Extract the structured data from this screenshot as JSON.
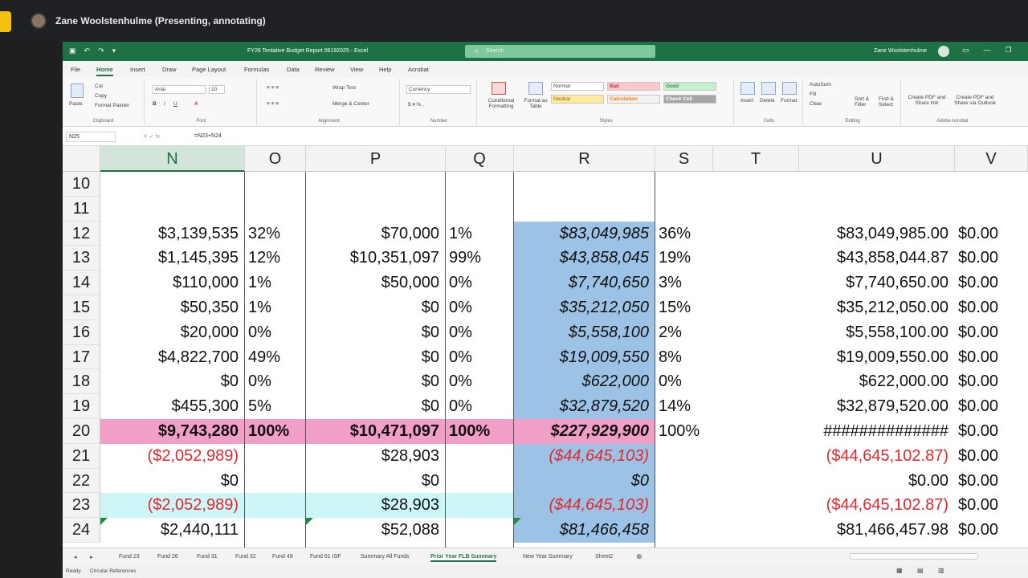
{
  "meeting": {
    "presenter_label": "Zane Woolstenhulme (Presenting, annotating)"
  },
  "excel": {
    "doc_title": "FY26 Tentative Budget Report 06192025  -  Excel",
    "search_placeholder": "Search",
    "user_name": "Zane Woolstenhulme",
    "tabs": [
      "File",
      "Home",
      "Insert",
      "Draw",
      "Page Layout",
      "Formulas",
      "Data",
      "Review",
      "View",
      "Help",
      "Acrobat"
    ],
    "ribbon": {
      "clipboard": {
        "paste": "Paste",
        "cut": "Cut",
        "copy": "Copy",
        "format_painter": "Format Painter",
        "label": "Clipboard"
      },
      "font": {
        "name": "Arial",
        "size": "10",
        "label": "Font"
      },
      "alignment": {
        "wrap": "Wrap Text",
        "merge": "Merge & Center",
        "label": "Alignment"
      },
      "number": {
        "format": "Currency",
        "label": "Number"
      },
      "styles": {
        "conditional": "Conditional Formatting",
        "format_table": "Format as Table",
        "normal": "Normal",
        "bad": "Bad",
        "good": "Good",
        "neutral": "Neutral",
        "calculation": "Calculation",
        "check_cell": "Check Cell",
        "label": "Styles"
      },
      "cells": {
        "insert": "Insert",
        "delete": "Delete",
        "format": "Format",
        "label": "Cells"
      },
      "editing": {
        "autosum": "AutoSum",
        "fill": "Fill",
        "clear": "Clear",
        "sort": "Sort & Filter",
        "find": "Find & Select",
        "label": "Editing"
      },
      "acrobat": {
        "create_pdf": "Create PDF and Share link",
        "create_outlook": "Create PDF and Share via Outlook",
        "label": "Adobe Acrobat"
      }
    },
    "name_box": "N25",
    "formula": "=N23+N24",
    "columns": [
      "N",
      "O",
      "P",
      "Q",
      "R",
      "S",
      "T",
      "U",
      "V"
    ],
    "rows": [
      {
        "num": "10",
        "N": "",
        "O": "",
        "P": "",
        "Q": "",
        "R": "",
        "S": "",
        "U": "",
        "V": ""
      },
      {
        "num": "11",
        "N": "",
        "O": "",
        "P": "",
        "Q": "",
        "R": "",
        "S": "",
        "U": "",
        "V": ""
      },
      {
        "num": "12",
        "N": "$3,139,535",
        "O": "32%",
        "P": "$70,000",
        "Q": "1%",
        "R": "$83,049,985",
        "S": "36%",
        "U": "$83,049,985.00",
        "V": "$0.00"
      },
      {
        "num": "13",
        "N": "$1,145,395",
        "O": "12%",
        "P": "$10,351,097",
        "Q": "99%",
        "R": "$43,858,045",
        "S": "19%",
        "U": "$43,858,044.87",
        "V": "$0.00"
      },
      {
        "num": "14",
        "N": "$110,000",
        "O": "1%",
        "P": "$50,000",
        "Q": "0%",
        "R": "$7,740,650",
        "S": "3%",
        "U": "$7,740,650.00",
        "V": "$0.00"
      },
      {
        "num": "15",
        "N": "$50,350",
        "O": "1%",
        "P": "$0",
        "Q": "0%",
        "R": "$35,212,050",
        "S": "15%",
        "U": "$35,212,050.00",
        "V": "$0.00"
      },
      {
        "num": "16",
        "N": "$20,000",
        "O": "0%",
        "P": "$0",
        "Q": "0%",
        "R": "$5,558,100",
        "S": "2%",
        "U": "$5,558,100.00",
        "V": "$0.00"
      },
      {
        "num": "17",
        "N": "$4,822,700",
        "O": "49%",
        "P": "$0",
        "Q": "0%",
        "R": "$19,009,550",
        "S": "8%",
        "U": "$19,009,550.00",
        "V": "$0.00"
      },
      {
        "num": "18",
        "N": "$0",
        "O": "0%",
        "P": "$0",
        "Q": "0%",
        "R": "$622,000",
        "S": "0%",
        "U": "$622,000.00",
        "V": "$0.00"
      },
      {
        "num": "19",
        "N": "$455,300",
        "O": "5%",
        "P": "$0",
        "Q": "0%",
        "R": "$32,879,520",
        "S": "14%",
        "U": "$32,879,520.00",
        "V": "$0.00"
      },
      {
        "num": "20",
        "N": "$9,743,280",
        "O": "100%",
        "P": "$10,471,097",
        "Q": "100%",
        "R": "$227,929,900",
        "S": "100%",
        "U": "##############",
        "V": "$0.00"
      },
      {
        "num": "21",
        "N": "($2,052,989)",
        "O": "",
        "P": "$28,903",
        "Q": "",
        "R": "($44,645,103)",
        "S": "",
        "U": "($44,645,102.87)",
        "V": "$0.00"
      },
      {
        "num": "22",
        "N": "$0",
        "O": "",
        "P": "$0",
        "Q": "",
        "R": "$0",
        "S": "",
        "U": "$0.00",
        "V": "$0.00"
      },
      {
        "num": "23",
        "N": "($2,052,989)",
        "O": "",
        "P": "$28,903",
        "Q": "",
        "R": "($44,645,103)",
        "S": "",
        "U": "($44,645,102.87)",
        "V": "$0.00"
      },
      {
        "num": "24",
        "N": "$2,440,111",
        "O": "",
        "P": "$52,088",
        "Q": "",
        "R": "$81,466,458",
        "S": "",
        "U": "$81,466,457.98",
        "V": "$0.00"
      }
    ],
    "sheets": [
      "Fund 23",
      "Fund 26",
      "Fund 31",
      "Fund 32",
      "Fund 49",
      "Fund 61 ISF",
      "Summary All Funds",
      "Prior Year FLB Summary",
      "New Year Summary",
      "Sheet2"
    ],
    "active_sheet": "Prior Year FLB Summary",
    "status": {
      "ready": "Ready",
      "circular": "Circular References"
    },
    "colors": {
      "accent": "#1e7145",
      "blue_fill": "#9cc3e6",
      "pink_fill": "#f19fc6",
      "cyan_fill": "#ccf6f8",
      "negative": "#e3272c"
    }
  }
}
